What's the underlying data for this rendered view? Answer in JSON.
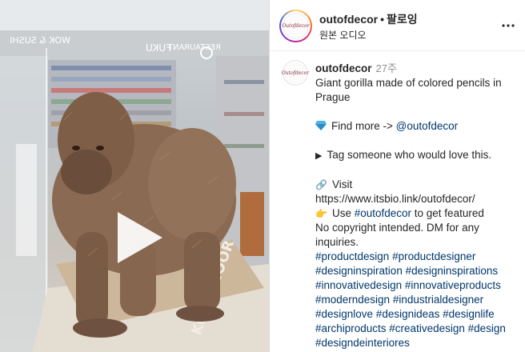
{
  "header": {
    "username": "outofdecor",
    "separator": "•",
    "follow_label": "팔로잉",
    "audio_label": "원본 오디오",
    "avatar_text": "Outofdecor",
    "more_icon": "more-horizontal-icon"
  },
  "media": {
    "type": "video",
    "play_icon": "play-icon",
    "signage": {
      "left": "WOK & SUSHI",
      "right": "RESTAURANT",
      "brand": "FUKU",
      "base": "KOH-I-NOOR"
    }
  },
  "caption": {
    "username": "outofdecor",
    "time": "27주",
    "line1": "Giant gorilla made of colored pencils in Prague",
    "find_more_text": "Find more -> ",
    "find_more_link": "@outofdecor",
    "tag_text": "Tag someone who would love this.",
    "visit_label": "Visit",
    "visit_url": "https://www.itsbio.link/outofdecor/",
    "use_prefix": "Use ",
    "use_hashtag": "#outofdecor",
    "use_suffix": " to get featured",
    "copyright": "No copyright intended. DM for any inquiries.",
    "hashtags": [
      "#productdesign #productdesigner",
      "#designinspiration #designinspirations",
      "#innovativedesign #innovativeproducts",
      "#moderndesign #industrialdesigner",
      "#designlove #designideas #designlife",
      "#archiproducts #creativedesign #design",
      "#designdeinteriores"
    ]
  },
  "colors": {
    "link": "#00376b",
    "text": "#262626",
    "muted": "#8e8e8e",
    "border": "#dbdbdb"
  }
}
